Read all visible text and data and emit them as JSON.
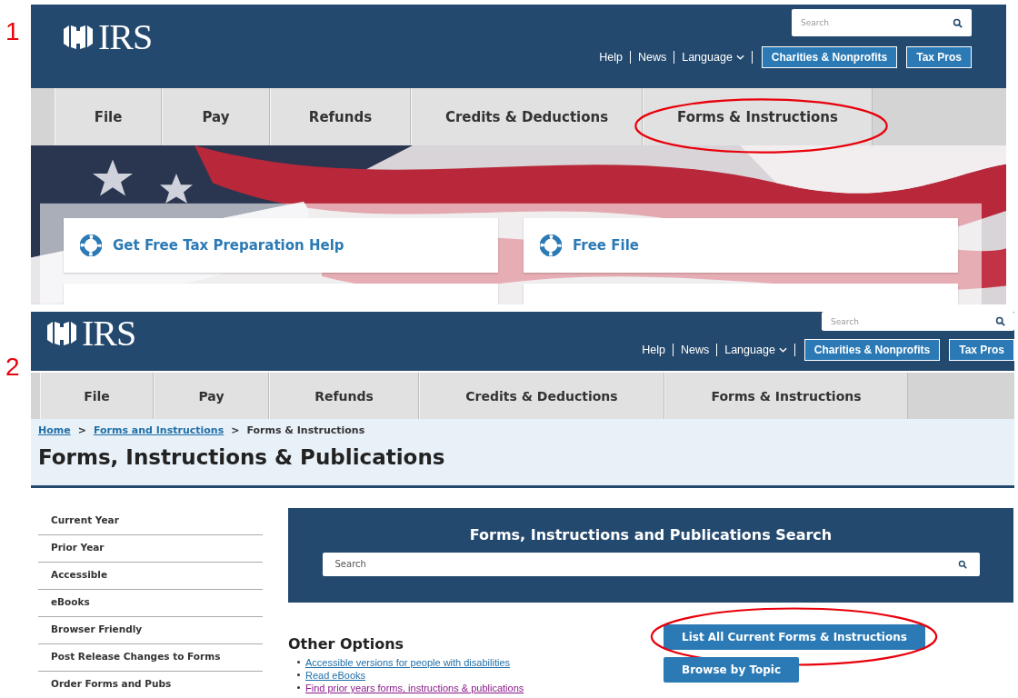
{
  "panels": [
    {
      "label": "1",
      "kind": "home",
      "header": {
        "logo": "IRS",
        "search_placeholder": "Search",
        "links": [
          "Help",
          "News",
          "Language"
        ],
        "buttons": [
          "Charities & Nonprofits",
          "Tax Pros"
        ]
      },
      "nav": [
        {
          "label": "File",
          "highlighted": false
        },
        {
          "label": "Pay",
          "highlighted": false
        },
        {
          "label": "Refunds",
          "highlighted": false
        },
        {
          "label": "Credits & Deductions",
          "highlighted": false
        },
        {
          "label": "Forms & Instructions",
          "highlighted": true
        }
      ],
      "cards": [
        {
          "kind": "link",
          "title": "Get Free Tax Preparation Help"
        },
        {
          "kind": "link",
          "title": "Free File"
        },
        {
          "kind": "cut"
        },
        {
          "kind": "cut"
        }
      ]
    },
    {
      "label": "2",
      "kind": "forms",
      "header": {
        "logo": "IRS",
        "search_placeholder": "Search",
        "links": [
          "Help",
          "News",
          "Language"
        ],
        "buttons": [
          "Charities & Nonprofits",
          "Tax Pros"
        ]
      },
      "nav": [
        {
          "label": "File",
          "highlighted": false
        },
        {
          "label": "Pay",
          "highlighted": false
        },
        {
          "label": "Refunds",
          "highlighted": false
        },
        {
          "label": "Credits & Deductions",
          "highlighted": false
        },
        {
          "label": "Forms & Instructions",
          "highlighted": false
        }
      ],
      "breadcrumb": [
        {
          "kind": "crumb",
          "label": "Home",
          "link": true
        },
        {
          "kind": "separator",
          "label": ">"
        },
        {
          "kind": "crumb",
          "label": "Forms and Instructions",
          "link": true
        },
        {
          "kind": "separator",
          "label": ">"
        },
        {
          "kind": "crumb",
          "label": "Forms & Instructions",
          "link": false
        }
      ],
      "title": "Forms, Instructions & Publications",
      "sidebar": [
        "Current Year",
        "Prior Year",
        "Accessible",
        "eBooks",
        "Browser Friendly",
        "Post Release Changes to Forms",
        "Order Forms and Pubs"
      ],
      "search_panel": {
        "title": "Forms, Instructions and Publications Search",
        "placeholder": "Search"
      },
      "other_options": {
        "title": "Other Options",
        "links": [
          {
            "label": "Accessible versions for people with disabilities",
            "visited": false
          },
          {
            "label": "Read eBooks",
            "visited": false
          },
          {
            "label": "Find prior years forms, instructions & publications",
            "visited": true
          }
        ]
      },
      "actions": [
        {
          "label": "List All Current Forms & Instructions",
          "highlighted": true
        },
        {
          "label": "Browse by Topic",
          "highlighted": false
        }
      ]
    }
  ]
}
